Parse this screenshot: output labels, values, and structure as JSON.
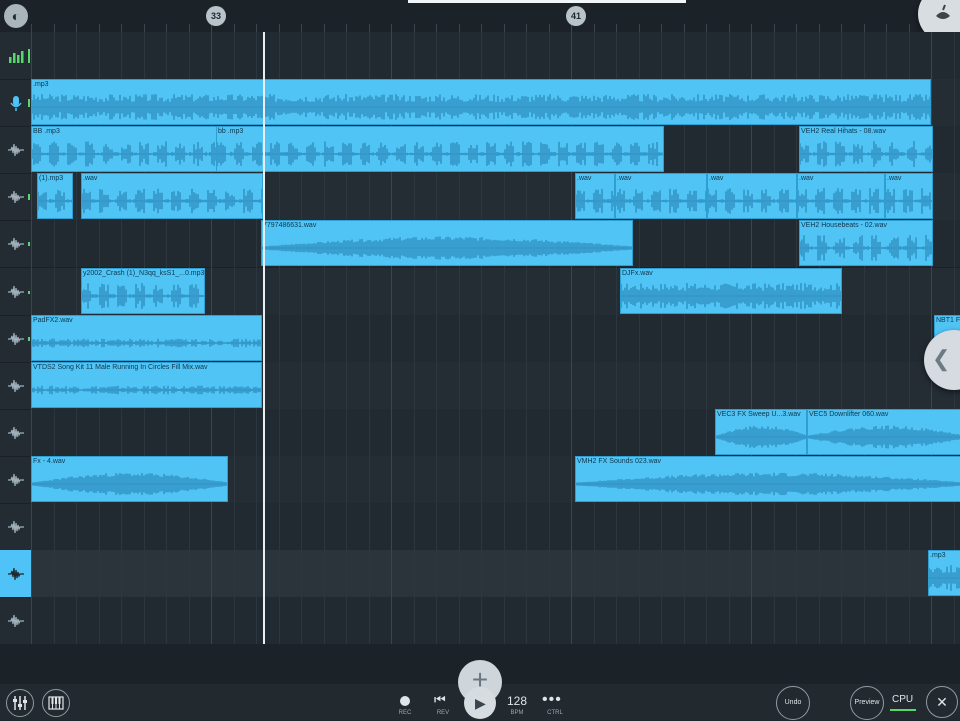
{
  "ruler": {
    "bar_markers": [
      "33",
      "41"
    ]
  },
  "tracks": [
    {
      "icon": "mixer-levels-icon"
    },
    {
      "icon": "microphone-icon"
    },
    {
      "icon": "waveform-icon"
    },
    {
      "icon": "waveform-icon"
    },
    {
      "icon": "waveform-icon"
    },
    {
      "icon": "waveform-icon"
    },
    {
      "icon": "waveform-icon"
    },
    {
      "icon": "waveform-icon"
    },
    {
      "icon": "waveform-icon"
    },
    {
      "icon": "waveform-icon"
    },
    {
      "icon": "waveform-icon"
    },
    {
      "icon": "waveform-icon"
    },
    {
      "icon": "waveform-icon"
    }
  ],
  "clips": [
    {
      "lane": 1,
      "name": ".mp3"
    },
    {
      "lane": 2,
      "name": "BB .mp3"
    },
    {
      "lane": 2,
      "name": "bb .mp3"
    },
    {
      "lane": 2,
      "name": "VEH2 Real Hihats - 08.wav"
    },
    {
      "lane": 3,
      "name": "(1).mp3"
    },
    {
      "lane": 3,
      "name": ".wav"
    },
    {
      "lane": 3,
      "name": ".wav"
    },
    {
      "lane": 3,
      "name": ".wav"
    },
    {
      "lane": 3,
      "name": ".wav"
    },
    {
      "lane": 3,
      "name": ".wav"
    },
    {
      "lane": 3,
      "name": ".wav"
    },
    {
      "lane": 4,
      "name": "7797486631.wav"
    },
    {
      "lane": 4,
      "name": "VEH2 Housebeats - 02.wav"
    },
    {
      "lane": 5,
      "name": "y2002_Crash (1)_N3qq_ksS1_...0.mp3"
    },
    {
      "lane": 5,
      "name": "DJFx.wav"
    },
    {
      "lane": 6,
      "name": "PadFX2.wav"
    },
    {
      "lane": 6,
      "name": "NBT1 F"
    },
    {
      "lane": 7,
      "name": "VTDS2 Song Kit 11 Male Running In Circles Fill Mix.wav"
    },
    {
      "lane": 8,
      "name": "VEC3 FX Sweep U...3.wav"
    },
    {
      "lane": 8,
      "name": "VEC5 Downlifter 060.wav"
    },
    {
      "lane": 9,
      "name": "Fx - 4.wav"
    },
    {
      "lane": 9,
      "name": "VMH2 FX Sounds 023.wav"
    },
    {
      "lane": 11,
      "name": ".mp3"
    }
  ],
  "transport": {
    "rec": "REC",
    "rev": "REV",
    "bpm_value": "128",
    "bpm_label": "BPM",
    "ctrl": "CTRL",
    "undo": "Undo",
    "preview": "Preview",
    "cpu": "CPU"
  },
  "colors": {
    "clip": "#50c4f5",
    "wave": "#2f8fc0",
    "accent": "#57d86b"
  }
}
